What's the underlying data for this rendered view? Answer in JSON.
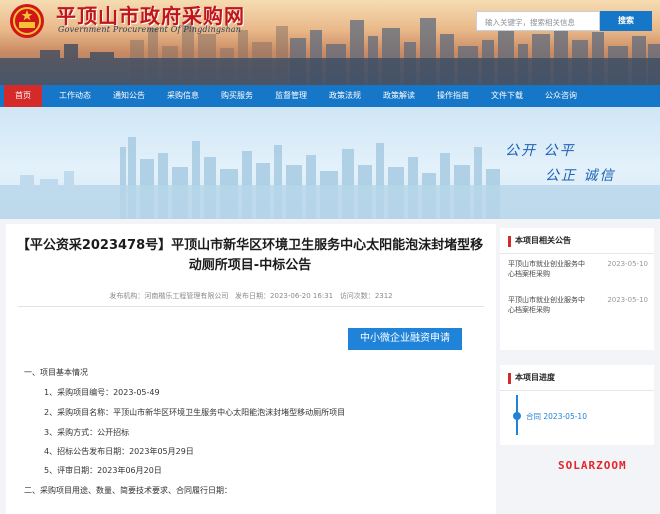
{
  "header": {
    "site_title": "平顶山市政府采购网",
    "site_subtitle": "Government Procurement Of Pingdingshan",
    "search_placeholder": "输入关键字，搜索相关信息",
    "search_button": "搜索"
  },
  "nav": {
    "items": [
      "首页",
      "工作动态",
      "通知公告",
      "采购信息",
      "购买服务",
      "监督管理",
      "政策法规",
      "政策解读",
      "操作指南",
      "文件下载",
      "公众咨询"
    ],
    "active_index": 0
  },
  "banner": {
    "slogan_line1": "公开  公平",
    "slogan_line2": "公正  诚信"
  },
  "article": {
    "title": "【平公资采2023478号】平顶山市新华区环境卫生服务中心太阳能泡沫封堵型移动厕所项目-中标公告",
    "meta_publisher_label": "发布机构：",
    "meta_publisher": "河南楷乐工程管理有限公司",
    "meta_date_label": "发布日期：",
    "meta_date": "2023-06-20 16:31",
    "meta_views_label": "访问次数：",
    "meta_views": "2312",
    "apply_button": "中小微企业融资申请",
    "lines": [
      "一、项目基本情况",
      "1、采购项目编号：2023-05-49",
      "2、采购项目名称：平顶山市新华区环境卫生服务中心太阳能泡沫封堵型移动厕所项目",
      "3、采购方式：公开招标",
      "4、招标公告发布日期：2023年05月29日",
      "5、评审日期：2023年06月20日",
      "二、采购项目用途、数量、简要技术要求、合同履行日期："
    ]
  },
  "sidebar": {
    "related_title": "本项目相关公告",
    "related_items": [
      {
        "line1": "平顶山市就业创业服务中",
        "line2": "心档案柜采购",
        "date": "2023-05-10"
      },
      {
        "line1": "平顶山市就业创业服务中",
        "line2": "心档案柜采购",
        "date": "2023-05-10"
      }
    ],
    "progress_title": "本项目进度",
    "progress_item": "合同 2023-05-10"
  },
  "watermark": "SOLARZOOM",
  "colors": {
    "nav_blue": "#1676c7",
    "accent_red": "#d42a2a",
    "link_blue": "#1f83d9"
  }
}
